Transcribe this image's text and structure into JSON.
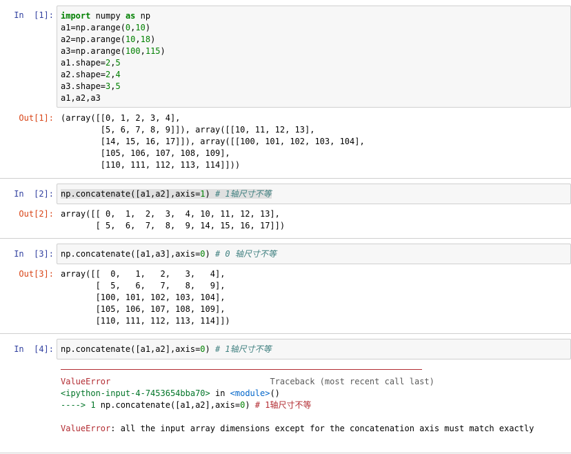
{
  "cells": [
    {
      "in_prompt": "In  [1]:",
      "code": {
        "l1_kw1": "import",
        "l1_mod": " numpy ",
        "l1_kw2": "as",
        "l1_alias": " np",
        "l2_pre": "a1=np.arange(",
        "l2_a": "0",
        "l2_c": ",",
        "l2_b": "10",
        "l2_post": ")",
        "l3_pre": "a2=np.arange(",
        "l3_a": "10",
        "l3_c": ",",
        "l3_b": "18",
        "l3_post": ")",
        "l4_pre": "a3=np.arange(",
        "l4_a": "100",
        "l4_c": ",",
        "l4_b": "115",
        "l4_post": ")",
        "l5_pre": "a1.shape=",
        "l5_a": "2",
        "l5_c": ",",
        "l5_b": "5",
        "l6_pre": "a2.shape=",
        "l6_a": "2",
        "l6_c": ",",
        "l6_b": "4",
        "l7_pre": "a3.shape=",
        "l7_a": "3",
        "l7_c": ",",
        "l7_b": "5",
        "l8": "a1,a2,a3"
      },
      "out_prompt": "Out[1]:",
      "output": "(array([[0, 1, 2, 3, 4],\n        [5, 6, 7, 8, 9]]), array([[10, 11, 12, 13],\n        [14, 15, 16, 17]]), array([[100, 101, 102, 103, 104],\n        [105, 106, 107, 108, 109],\n        [110, 111, 112, 113, 114]]))"
    },
    {
      "in_prompt": "In  [2]:",
      "code": {
        "pre": "np.concatenate([a1,a2],axis=",
        "num": "1",
        "post": ") ",
        "comment": "# 1轴尺寸不等"
      },
      "out_prompt": "Out[2]:",
      "output": "array([[ 0,  1,  2,  3,  4, 10, 11, 12, 13],\n       [ 5,  6,  7,  8,  9, 14, 15, 16, 17]])"
    },
    {
      "in_prompt": "In  [3]:",
      "code": {
        "pre": "np.concatenate([a1,a3],axis=",
        "num": "0",
        "post": ") ",
        "comment": "# 0 轴尺寸不等"
      },
      "out_prompt": "Out[3]:",
      "output": "array([[  0,   1,   2,   3,   4],\n       [  5,   6,   7,   8,   9],\n       [100, 101, 102, 103, 104],\n       [105, 106, 107, 108, 109],\n       [110, 111, 112, 113, 114]])"
    },
    {
      "in_prompt": "In  [4]:",
      "code": {
        "pre": "np.concatenate([a1,a2],axis=",
        "num": "0",
        "post": ") ",
        "comment": "# 1轴尺寸不等"
      },
      "error": {
        "name": "ValueError",
        "traceback_header": "Traceback (most recent call last)",
        "location_file": "<ipython-input-4-7453654bba70>",
        "location_in": " in ",
        "location_module": "<module>",
        "location_paren": "()",
        "arrow": "----> 1 ",
        "arrow_code_pre": "np.concatenate([a1,a2],axis=",
        "arrow_code_num": "0",
        "arrow_code_post": ") ",
        "arrow_comment": "# 1轴尺寸不等",
        "message_name": "ValueError",
        "message": ": all the input array dimensions except for the concatenation axis must match exactly"
      }
    }
  ]
}
